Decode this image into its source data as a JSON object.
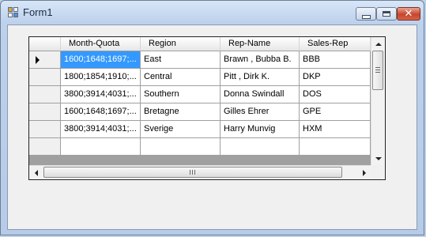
{
  "window": {
    "title": "Form1",
    "icon": "app-form-icon",
    "controls": [
      "minimize-icon",
      "maximize-icon",
      "close-icon"
    ]
  },
  "grid": {
    "columns": [
      "Month-Quota",
      "Region",
      "Rep-Name",
      "Sales-Rep"
    ],
    "rows": [
      [
        "1600;1648;1697;...",
        "East",
        "Brawn , Bubba B.",
        "BBB"
      ],
      [
        "1800;1854;1910;...",
        "Central",
        "Pitt , Dirk K.",
        "DKP"
      ],
      [
        "3800;3914;4031;...",
        "Southern",
        "Donna Swindall",
        "DOS"
      ],
      [
        "1600;1648;1697;...",
        "Bretagne",
        "Gilles Ehrer",
        "GPE"
      ],
      [
        "3800;3914;4031;...",
        "Sverige",
        "Harry Munvig",
        "HXM"
      ]
    ],
    "selected_row": 0,
    "selected_col": 0,
    "current_row_indicator": "arrow-right-icon"
  },
  "colors": {
    "selection": "#3399ff",
    "title_bar": "#bcd0ea",
    "close_button": "#c7452b"
  }
}
